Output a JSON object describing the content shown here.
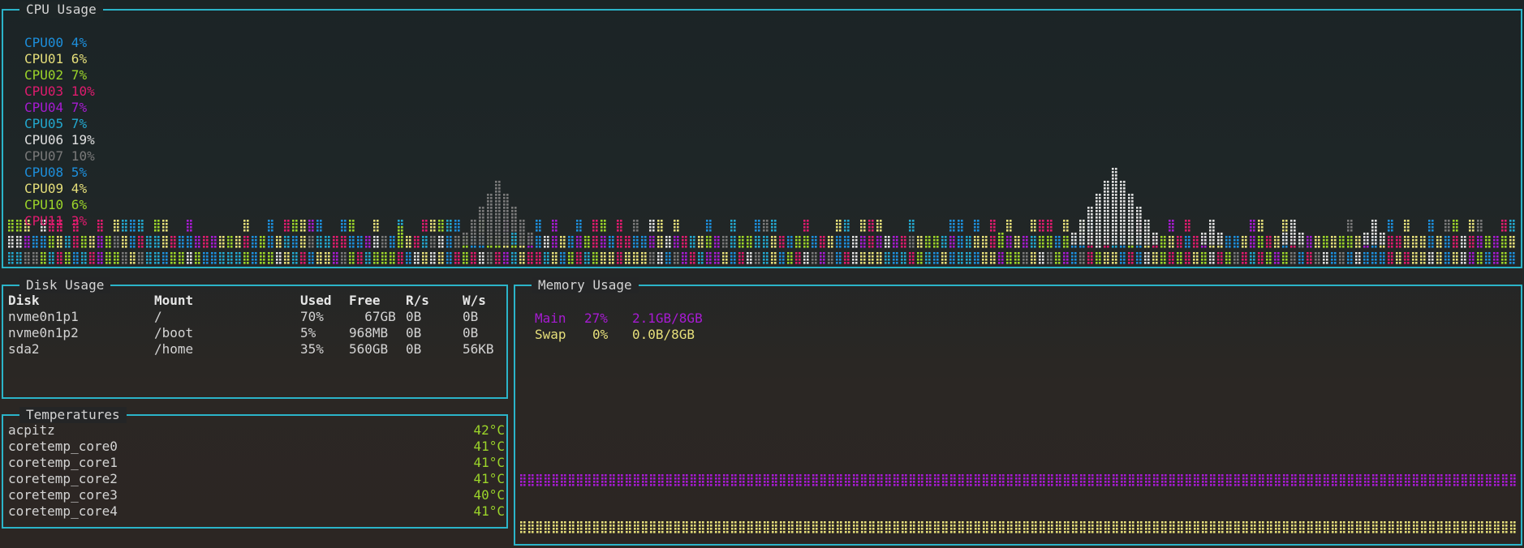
{
  "colors": {
    "border": "#2bb4c9",
    "cpu": [
      "#1d8fdc",
      "#e6df7a",
      "#9cd52a",
      "#e01b6e",
      "#a71bd2",
      "#23a8cf",
      "#e0e0e0",
      "#7a7a7a",
      "#1d8fdc",
      "#e6df7a",
      "#9cd52a",
      "#e01b6e"
    ],
    "mem_main": "#a71bd2",
    "mem_swap": "#e6df7a",
    "temp": "#9cd52a"
  },
  "cpu_panel": {
    "title": "CPU Usage",
    "cpus": [
      {
        "label": "CPU00",
        "value": "4%"
      },
      {
        "label": "CPU01",
        "value": "6%"
      },
      {
        "label": "CPU02",
        "value": "7%"
      },
      {
        "label": "CPU03",
        "value": "10%"
      },
      {
        "label": "CPU04",
        "value": "7%"
      },
      {
        "label": "CPU05",
        "value": "7%"
      },
      {
        "label": "CPU06",
        "value": "19%"
      },
      {
        "label": "CPU07",
        "value": "10%"
      },
      {
        "label": "CPU08",
        "value": "5%"
      },
      {
        "label": "CPU09",
        "value": "4%"
      },
      {
        "label": "CPU10",
        "value": "6%"
      },
      {
        "label": "CPU11",
        "value": "3%"
      }
    ]
  },
  "disk_panel": {
    "title": "Disk Usage",
    "headers": [
      "Disk",
      "Mount",
      "Used",
      "Free",
      "R/s",
      "W/s"
    ],
    "rows": [
      [
        "nvme0n1p1",
        "/",
        "70%",
        "  67GB",
        "0B",
        "0B"
      ],
      [
        "nvme0n1p2",
        "/boot",
        "5%",
        "968MB",
        "0B",
        "0B"
      ],
      [
        "sda2",
        "/home",
        "35%",
        "560GB",
        "0B",
        "56KB"
      ]
    ]
  },
  "temp_panel": {
    "title": "Temperatures",
    "rows": [
      {
        "name": "acpitz",
        "value": "42°C"
      },
      {
        "name": "coretemp_core0",
        "value": "41°C"
      },
      {
        "name": "coretemp_core1",
        "value": "41°C"
      },
      {
        "name": "coretemp_core2",
        "value": "41°C"
      },
      {
        "name": "coretemp_core3",
        "value": "40°C"
      },
      {
        "name": "coretemp_core4",
        "value": "41°C"
      }
    ]
  },
  "mem_panel": {
    "title": "Memory Usage",
    "main": {
      "label": "Main",
      "percent": "27%",
      "amount": "2.1GB/8GB",
      "fraction": 0.27
    },
    "swap": {
      "label": "Swap",
      "percent": "0%",
      "amount": "0.0B/8GB",
      "fraction": 0.0
    }
  }
}
